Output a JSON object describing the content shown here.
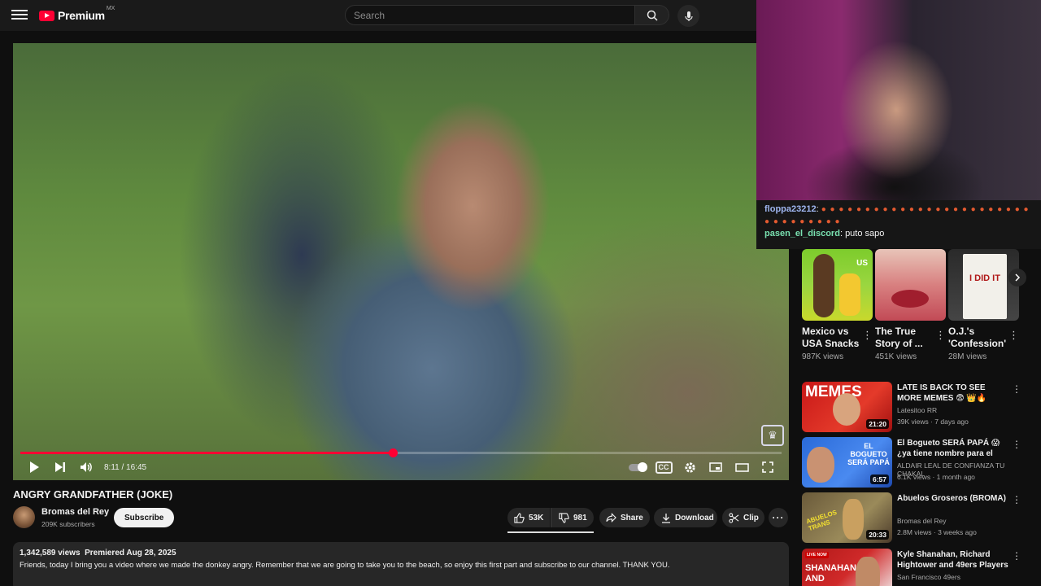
{
  "header": {
    "logo_text": "Premium",
    "logo_region": "MX",
    "search_placeholder": "Search"
  },
  "player": {
    "time": "8:11 / 16:45",
    "progress": 0.489,
    "watermark": "♛"
  },
  "overlay": {
    "chat": [
      {
        "user": "floppa23212",
        "message": ""
      },
      {
        "user": "pasen_el_discord",
        "message": "puto sapo"
      }
    ]
  },
  "video": {
    "title": "ANGRY GRANDFATHER (JOKE)",
    "channel": "Bromas del Rey",
    "subscribers": "209K subscribers",
    "subscribe_label": "Subscribe",
    "likes": "53K",
    "dislikes": "981",
    "share_label": "Share",
    "download_label": "Download",
    "clip_label": "Clip",
    "views": "1,342,589 views",
    "premiered": "Premiered Aug 28, 2025",
    "description": "Friends, today I bring you a video where we made the donkey angry. Remember that we are going to take you to the beach, so enjoy this first part and subscribe to our channel. THANK YOU."
  },
  "shorts": [
    {
      "title": "Mexico vs USA Snacks",
      "views": "987K views",
      "thumb_label": "US"
    },
    {
      "title": "The True Story of ...",
      "views": "451K views",
      "thumb_label": ""
    },
    {
      "title": "O.J.'s 'Confession'",
      "views": "28M views",
      "thumb_label": "I DID IT"
    }
  ],
  "recommended": [
    {
      "title": "LATE IS BACK TO SEE MORE MEMES 😨 👑🔥",
      "channel": "Latesitoo RR",
      "meta": "39K views · 7 days ago",
      "duration": "21:20",
      "thumb_label": "MEMES"
    },
    {
      "title": "El Bogueto SERÁ PAPÁ 😱 ¿ya tiene nombre para el bebé?",
      "channel": "ALDAIR LEAL DE CONFIANZA TU CHAKAL",
      "meta": "6.1K views · 1 month ago",
      "duration": "6:57",
      "thumb_label": "EL BOGUETO SERÁ PAPÁ"
    },
    {
      "title": "Abuelos Groseros (BROMA)",
      "channel": "Bromas del Rey",
      "meta": "2.8M views · 3 weeks ago",
      "duration": "20:33",
      "thumb_label": "ABUELOS TRANS"
    },
    {
      "title": "Kyle Shanahan, Richard Hightower and 49ers Players ...",
      "channel": "San Francisco 49ers",
      "meta": "",
      "duration": "",
      "thumb_label": "SHANAHAN AND",
      "live_label": "LIVE NOW"
    }
  ]
}
